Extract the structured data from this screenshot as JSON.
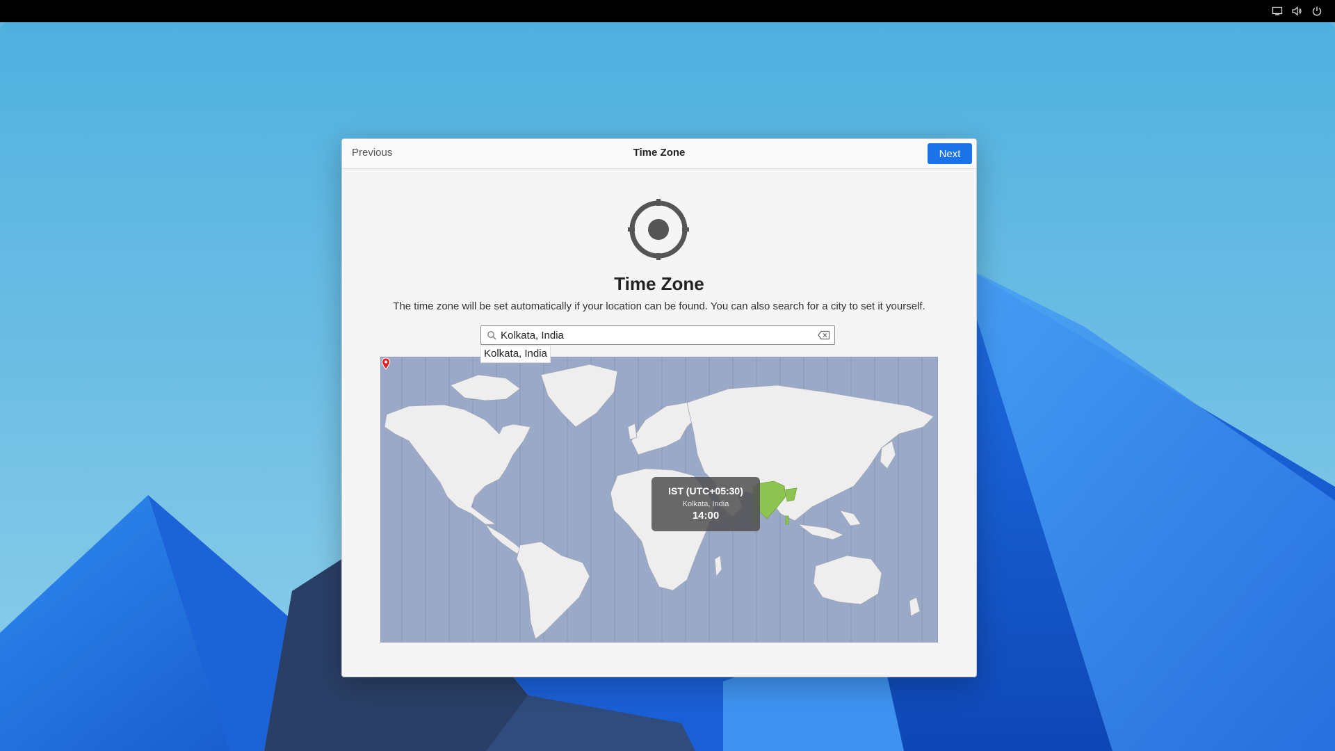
{
  "topbar": {
    "icons": [
      "display-icon",
      "volume-icon",
      "power-icon"
    ]
  },
  "header": {
    "previous_label": "Previous",
    "title": "Time Zone",
    "next_label": "Next"
  },
  "main": {
    "icon": "location-crosshair-icon",
    "title": "Time Zone",
    "description": "The time zone will be set automatically if your location can be found. You can also search for a city to set it yourself."
  },
  "search": {
    "value": "Kolkata, India",
    "suggestion": "Kolkata, India"
  },
  "map": {
    "selected_zone": {
      "name": "IST (UTC+05:30)",
      "city": "Kolkata, India",
      "time": "14:00",
      "highlight_color": "#8dc451"
    },
    "ocean_color": "#9aa9c7",
    "land_color": "#efeeee"
  },
  "colors": {
    "accent": "#1a73e8"
  }
}
